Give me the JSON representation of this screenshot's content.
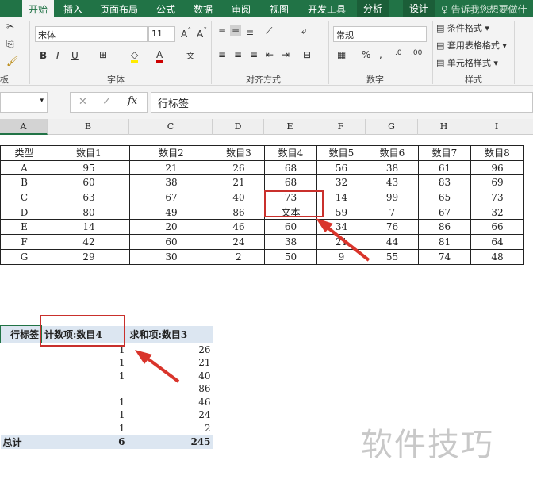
{
  "tabs": [
    "开始",
    "插入",
    "页面布局",
    "公式",
    "数据",
    "审阅",
    "视图",
    "开发工具",
    "分析",
    "设计"
  ],
  "tell_me": "告诉我您想要做什么",
  "ribbon": {
    "font_name": "宋体",
    "font_size": "11",
    "number_format": "常规",
    "conditional_format": "条件格式",
    "table_format": "套用表格格式",
    "cell_style": "单元格样式",
    "groups": {
      "clipboard": "板",
      "font": "字体",
      "alignment": "对齐方式",
      "number": "数字",
      "styles": "样式"
    }
  },
  "formula_bar": {
    "value": "行标签",
    "fx": "fx"
  },
  "columns": [
    "A",
    "B",
    "C",
    "D",
    "E",
    "F",
    "G",
    "H",
    "I"
  ],
  "data_table": {
    "headers": [
      "类型",
      "数目1",
      "数目2",
      "数目3",
      "数目4",
      "数目5",
      "数目6",
      "数目7",
      "数目8"
    ],
    "rows": [
      [
        "A",
        "95",
        "21",
        "26",
        "68",
        "56",
        "38",
        "61",
        "96"
      ],
      [
        "B",
        "60",
        "38",
        "21",
        "68",
        "32",
        "43",
        "83",
        "69"
      ],
      [
        "C",
        "63",
        "67",
        "40",
        "73",
        "14",
        "99",
        "65",
        "73"
      ],
      [
        "D",
        "80",
        "49",
        "86",
        "文本",
        "59",
        "7",
        "67",
        "32"
      ],
      [
        "E",
        "14",
        "20",
        "46",
        "60",
        "34",
        "76",
        "86",
        "66"
      ],
      [
        "F",
        "42",
        "60",
        "24",
        "38",
        "21",
        "44",
        "81",
        "64"
      ],
      [
        "G",
        "29",
        "30",
        "2",
        "50",
        "9",
        "55",
        "74",
        "48"
      ]
    ]
  },
  "pivot": {
    "headers": [
      "行标签",
      "计数项:数目4",
      "求和项:数目3"
    ],
    "rows": [
      [
        "",
        "1",
        "26"
      ],
      [
        "",
        "1",
        "21"
      ],
      [
        "",
        "1",
        "40"
      ],
      [
        "",
        "",
        "86"
      ],
      [
        "",
        "1",
        "46"
      ],
      [
        "",
        "1",
        "24"
      ],
      [
        "",
        "1",
        "2"
      ]
    ],
    "total": [
      "总计",
      "6",
      "245"
    ]
  },
  "watermark": "软件技巧",
  "colors": {
    "excel_green": "#217346",
    "highlight_red": "#c9302c",
    "pivot_header": "#dce6f1"
  }
}
